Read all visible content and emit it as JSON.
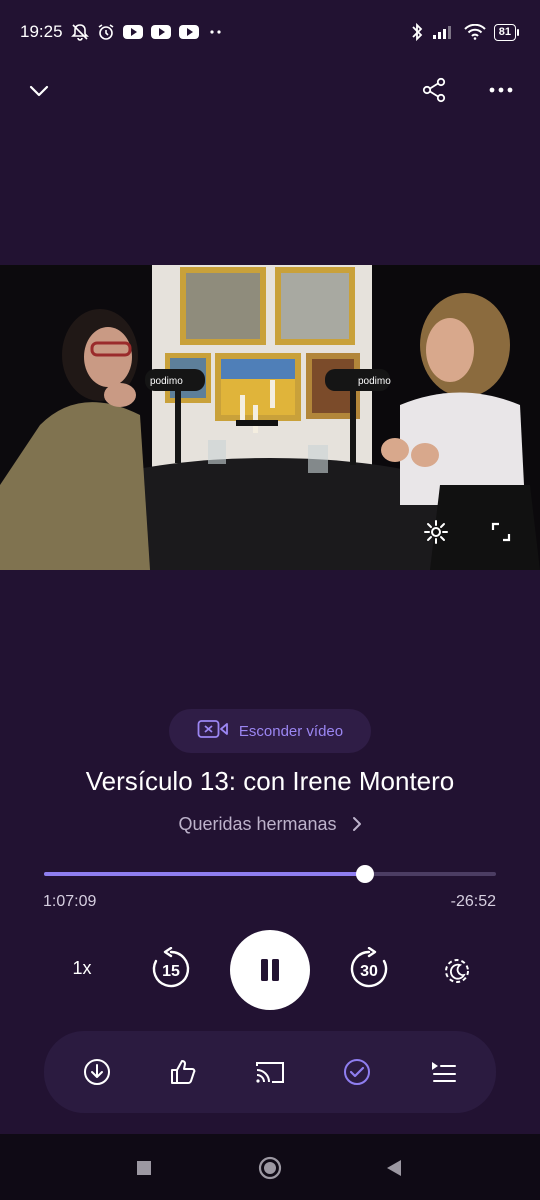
{
  "status_bar": {
    "time": "19:25",
    "battery": "81",
    "icons": [
      "bell-off-icon",
      "alarm-icon",
      "youtube-icon",
      "youtube-icon",
      "youtube-icon",
      "more-dots-icon",
      "bluetooth-icon",
      "signal-icon",
      "wifi-icon",
      "battery-icon"
    ]
  },
  "header": {
    "collapse_icon": "chevron-down-icon",
    "share_icon": "share-icon",
    "more_icon": "more-horizontal-icon"
  },
  "video": {
    "settings_icon": "gear-icon",
    "fullscreen_icon": "fullscreen-icon",
    "mic_brand": "podimo"
  },
  "hide_video_label": "Esconder vídeo",
  "episode": {
    "title": "Versículo 13: con Irene Montero",
    "show": "Queridas hermanas"
  },
  "player": {
    "elapsed": "1:07:09",
    "remaining": "-26:52",
    "progress_fraction": 0.71,
    "speed": "1x",
    "rewind_seconds": "15",
    "forward_seconds": "30"
  },
  "actions": [
    "download-icon",
    "like-icon",
    "cast-icon",
    "mark-played-icon",
    "queue-icon"
  ],
  "colors": {
    "background": "#221232",
    "accent": "#8f7ef0",
    "accent_text": "#9b86f2"
  }
}
